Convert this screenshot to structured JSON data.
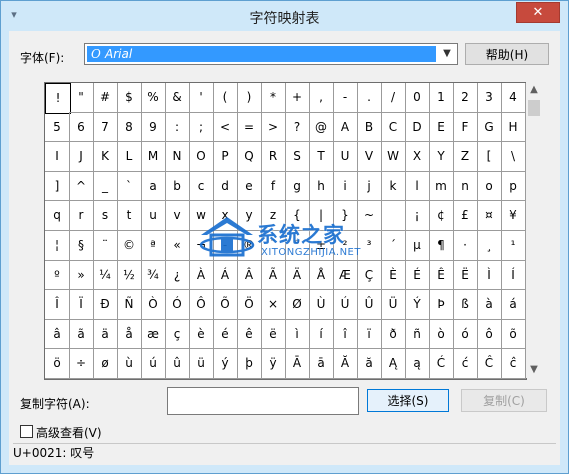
{
  "window": {
    "title": "字符映射表",
    "close_symbol": "✕"
  },
  "font": {
    "label": "字体(F):",
    "selected": "Arial",
    "glyph": "O"
  },
  "buttons": {
    "help": "帮助(H)",
    "select": "选择(S)",
    "copy": "复制(C)"
  },
  "grid": {
    "columns": 20,
    "selected_index": 0,
    "rows": [
      [
        "!",
        "\"",
        "#",
        "$",
        "%",
        "&",
        "'",
        "(",
        ")",
        "*",
        "+",
        ",",
        "-",
        ".",
        "/",
        "0",
        "1",
        "2",
        "3",
        "4"
      ],
      [
        "5",
        "6",
        "7",
        "8",
        "9",
        ":",
        ";",
        "<",
        "=",
        ">",
        "?",
        "@",
        "A",
        "B",
        "C",
        "D",
        "E",
        "F",
        "G",
        "H"
      ],
      [
        "I",
        "J",
        "K",
        "L",
        "M",
        "N",
        "O",
        "P",
        "Q",
        "R",
        "S",
        "T",
        "U",
        "V",
        "W",
        "X",
        "Y",
        "Z",
        "[",
        "\\"
      ],
      [
        "]",
        "^",
        "_",
        "`",
        "a",
        "b",
        "c",
        "d",
        "e",
        "f",
        "g",
        "h",
        "i",
        "j",
        "k",
        "l",
        "m",
        "n",
        "o",
        "p"
      ],
      [
        "q",
        "r",
        "s",
        "t",
        "u",
        "v",
        "w",
        "x",
        "y",
        "z",
        "{",
        "|",
        "}",
        "~",
        "",
        "¡",
        "¢",
        "£",
        "¤",
        "¥"
      ],
      [
        "¦",
        "§",
        "¨",
        "©",
        "ª",
        "«",
        "¬",
        "-",
        "®",
        "¯",
        "°",
        "±",
        "²",
        "³",
        "´",
        "µ",
        "¶",
        "·",
        "¸",
        "¹"
      ],
      [
        "º",
        "»",
        "¼",
        "½",
        "¾",
        "¿",
        "À",
        "Á",
        "Â",
        "Ã",
        "Ä",
        "Å",
        "Æ",
        "Ç",
        "È",
        "É",
        "Ê",
        "Ë",
        "Ì",
        "Í"
      ],
      [
        "Î",
        "Ï",
        "Ð",
        "Ñ",
        "Ò",
        "Ó",
        "Ô",
        "Õ",
        "Ö",
        "×",
        "Ø",
        "Ù",
        "Ú",
        "Û",
        "Ü",
        "Ý",
        "Þ",
        "ß",
        "à",
        "á"
      ],
      [
        "â",
        "ã",
        "ä",
        "å",
        "æ",
        "ç",
        "è",
        "é",
        "ê",
        "ë",
        "ì",
        "í",
        "î",
        "ï",
        "ð",
        "ñ",
        "ò",
        "ó",
        "ô",
        "õ"
      ],
      [
        "ö",
        "÷",
        "ø",
        "ù",
        "ú",
        "û",
        "ü",
        "ý",
        "þ",
        "ÿ",
        "Ā",
        "ā",
        "Ă",
        "ă",
        "Ą",
        "ą",
        "Ć",
        "ć",
        "Ĉ",
        "ĉ"
      ]
    ]
  },
  "copy": {
    "label": "复制字符(A):",
    "value": ""
  },
  "advanced": {
    "label": "高级查看(V)",
    "checked": false
  },
  "status": {
    "text": "U+0021: 叹号"
  },
  "watermark": {
    "title": "系统之家",
    "subtitle": "XITONGZHIJIA.NET"
  },
  "colors": {
    "accent": "#3399ff",
    "close": "#c74a3d",
    "frame": "#5e9fd0",
    "watermark": "#1a6fd0"
  }
}
